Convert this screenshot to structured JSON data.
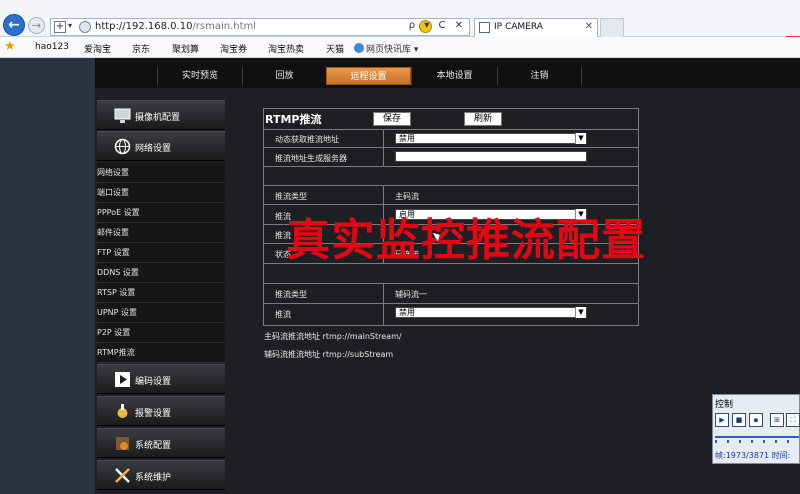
{
  "browser": {
    "url": "http://192.168.0.10/rsmain.html",
    "url_host": "http://192.168.0.10",
    "url_path": "/rsmain.html",
    "tab_title": "IP CAMERA",
    "search_caret": "ρ ▾ C ✕",
    "favorites": [
      "hao123",
      "爱淘宝",
      "京东",
      "聚划算",
      "淘宝券",
      "淘宝热卖",
      "天猫",
      "网页快讯库 ▾"
    ]
  },
  "top_tabs": [
    {
      "label": "实时预览"
    },
    {
      "label": "回放"
    },
    {
      "label": "远程设置"
    },
    {
      "label": "本地设置"
    },
    {
      "label": "注销"
    }
  ],
  "sidebar": {
    "major": [
      {
        "label": "摄像机配置",
        "icon": "monitor-icon"
      },
      {
        "label": "网络设置",
        "icon": "globe-icon"
      },
      {
        "label": "编码设置",
        "icon": "film-icon"
      },
      {
        "label": "报警设置",
        "icon": "alarm-icon"
      },
      {
        "label": "系统配置",
        "icon": "system-icon"
      },
      {
        "label": "系统维护",
        "icon": "tools-icon"
      }
    ],
    "network_sub": [
      "网络设置",
      "端口设置",
      "PPPoE 设置",
      "邮件设置",
      "FTP 设置",
      "DDNS 设置",
      "RTSP 设置",
      "UPNP 设置",
      "P2P 设置",
      "RTMP推流"
    ]
  },
  "form": {
    "title": "RTMP推流",
    "save_label": "保存",
    "refresh_label": "刷新",
    "rows": {
      "dynamic_label": "动态获取推流地址",
      "dynamic_value": "禁用",
      "server_label": "推流地址生成服务器",
      "server_value": "",
      "main_type_label": "推流类型",
      "main_type_value": "主码流",
      "main_push_label": "推流",
      "main_push_value": "启用",
      "main_push_label2": "推流",
      "main_state_label": "状态",
      "main_state_value": "已连接",
      "sub_type_label": "推流类型",
      "sub_type_value": "辅码流一",
      "sub_push_label": "推流",
      "sub_push_value": "禁用"
    },
    "main_stream_url": "主码流推流地址 rtmp://mainStream/",
    "sub_stream_url": "辅码流推流地址 rtmp://subStream"
  },
  "overlay_text": "真实监控推流配置",
  "control_panel": {
    "title": "控制",
    "frame_text": "帧:1973/3871 时间:"
  },
  "colors": {
    "accent_tab": "#d8843a",
    "watermark": "#e30613"
  }
}
